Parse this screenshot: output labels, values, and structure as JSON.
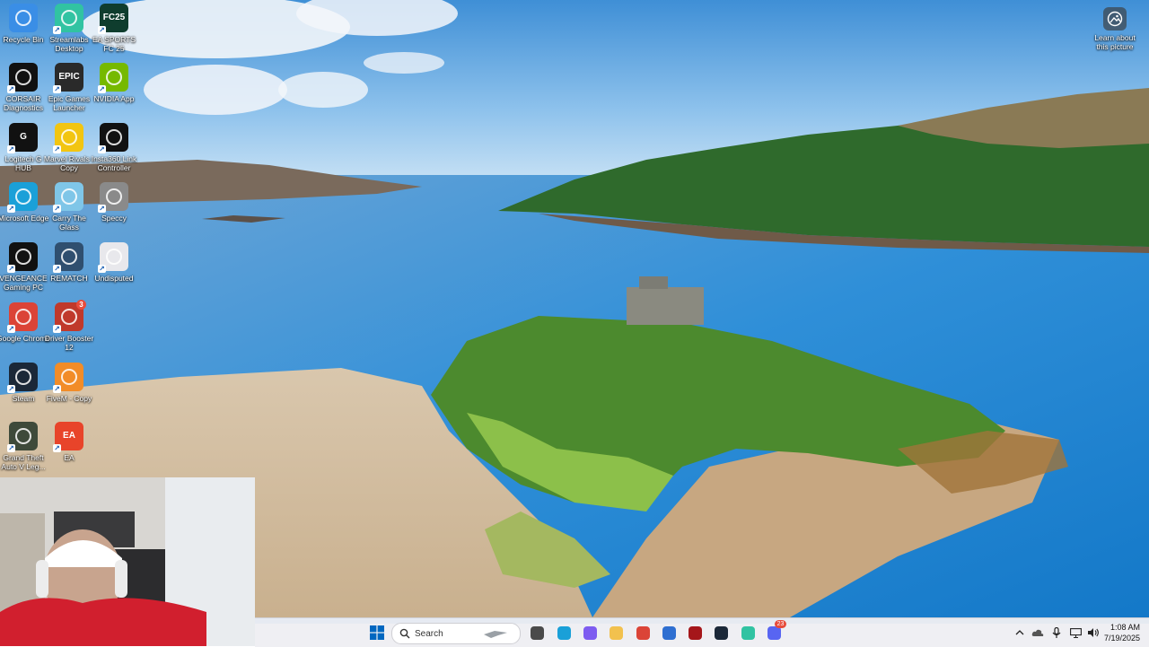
{
  "desktop": {
    "icons": [
      {
        "label": "Recycle Bin",
        "icon": "recycle-bin-icon",
        "color": "#3a8ee6"
      },
      {
        "label": "Streamlabs Desktop",
        "icon": "streamlabs-icon",
        "color": "#31c3a2"
      },
      {
        "label": "EA SPORTS FC 25",
        "icon": "ea-fc25-icon",
        "color": "#0f3d2e",
        "tile_text": "FC25"
      },
      {
        "label": "CORSAIR Diagnostics",
        "icon": "corsair-icon",
        "color": "#111111"
      },
      {
        "label": "Epic Games Launcher",
        "icon": "epic-games-icon",
        "color": "#2a2a2a",
        "tile_text": "EPIC"
      },
      {
        "label": "NVIDIA App",
        "icon": "nvidia-icon",
        "color": "#76b900"
      },
      {
        "label": "Logitech G HUB",
        "icon": "logitech-g-icon",
        "color": "#111111",
        "tile_text": "G"
      },
      {
        "label": "Marvel Rivals - Copy",
        "icon": "marvel-rivals-icon",
        "color": "#f2c511"
      },
      {
        "label": "Insta360 Link Controller",
        "icon": "insta360-icon",
        "color": "#111111"
      },
      {
        "label": "Microsoft Edge",
        "icon": "edge-icon",
        "color": "#1aa0d8"
      },
      {
        "label": "Carry The Glass",
        "icon": "carry-the-glass-icon",
        "color": "#7fc6e8"
      },
      {
        "label": "Speccy",
        "icon": "speccy-icon",
        "color": "#8a8a8a"
      },
      {
        "label": "VENGEANCE Gaming PC",
        "icon": "vengeance-icon",
        "color": "#111111"
      },
      {
        "label": "REMATCH",
        "icon": "rematch-icon",
        "color": "#2f4f6f"
      },
      {
        "label": "Undisputed",
        "icon": "undisputed-icon",
        "color": "#e8e8ec"
      },
      {
        "label": "Google Chrome",
        "icon": "chrome-icon",
        "color": "#db4437"
      },
      {
        "label": "Driver Booster 12",
        "icon": "driver-booster-icon",
        "color": "#c0392b",
        "badge": "3"
      },
      {
        "label": "Steam",
        "icon": "steam-icon",
        "color": "#1b2838"
      },
      {
        "label": "FiveM - Copy",
        "icon": "fivem-icon",
        "color": "#f28c28"
      },
      {
        "label": "Grand Theft Auto V Leg...",
        "icon": "gta-v-icon",
        "color": "#3e4a3a"
      },
      {
        "label": "EA",
        "icon": "ea-icon",
        "color": "#e8442a",
        "tile_text": "EA"
      }
    ],
    "learn_about": {
      "label": "Learn about this picture",
      "icon": "camera-icon"
    }
  },
  "taskbar": {
    "search_placeholder": "Search",
    "apps": [
      {
        "icon": "file-explorer-icon"
      },
      {
        "icon": "edge-icon"
      },
      {
        "icon": "copilot-icon"
      },
      {
        "icon": "folder-icon"
      },
      {
        "icon": "chrome-icon"
      },
      {
        "icon": "store-icon"
      },
      {
        "icon": "app-red-icon"
      },
      {
        "icon": "steam-icon"
      },
      {
        "icon": "streamlabs-icon"
      },
      {
        "icon": "discord-icon",
        "badge": "23"
      }
    ],
    "clock": {
      "time": "1:08 AM",
      "date": "7/19/2025"
    }
  },
  "colors": {
    "accent": "#0067c0",
    "taskbar_bg": "#eeeef2"
  }
}
